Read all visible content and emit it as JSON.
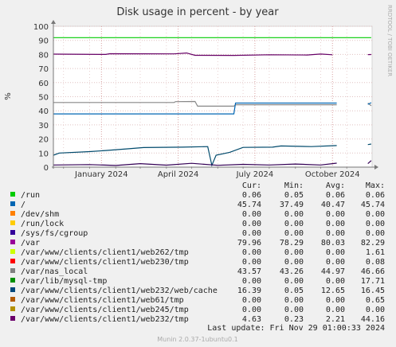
{
  "chart_data": {
    "type": "line",
    "title": "Disk usage in percent - by year",
    "ylabel": "%",
    "side_label": "RRDTOOL / TOBI OETIKER",
    "ylim": [
      0,
      100
    ],
    "yticks": [
      0,
      10,
      20,
      30,
      40,
      50,
      60,
      70,
      80,
      90,
      100
    ],
    "xlim": [
      "2023-11-19",
      "2024-12-01"
    ],
    "xticks": [
      {
        "label": "January 2024",
        "date": "2024-01-15"
      },
      {
        "label": "April 2024",
        "date": "2024-04-15"
      },
      {
        "label": "July 2024",
        "date": "2024-07-15"
      },
      {
        "label": "October 2024",
        "date": "2024-10-15"
      }
    ],
    "grid": true,
    "series": [
      {
        "name": "/run",
        "color": "#00cc00",
        "points": [
          [
            "2023-11-19",
            91.9
          ],
          [
            "2024-11-30",
            91.9
          ]
        ]
      },
      {
        "name": "/var",
        "color": "#660066",
        "points": [
          [
            "2023-11-19",
            80.2
          ],
          [
            "2024-01-20",
            80.0
          ],
          [
            "2024-01-25",
            80.5
          ],
          [
            "2024-04-10",
            80.4
          ],
          [
            "2024-04-25",
            81.0
          ],
          [
            "2024-05-05",
            79.4
          ],
          [
            "2024-06-20",
            79.3
          ],
          [
            "2024-08-01",
            79.8
          ],
          [
            "2024-09-15",
            79.6
          ],
          [
            "2024-10-01",
            80.3
          ],
          [
            "2024-10-15",
            79.8
          ],
          [
            "2024-10-20",
            null
          ],
          [
            "2024-11-26",
            79.9
          ],
          [
            "2024-11-30",
            79.96
          ]
        ]
      },
      {
        "name": "/var/nas_local",
        "color": "#888888",
        "points": [
          [
            "2023-11-19",
            45.9
          ],
          [
            "2024-04-10",
            45.9
          ],
          [
            "2024-04-12",
            46.5
          ],
          [
            "2024-05-05",
            46.6
          ],
          [
            "2024-05-08",
            43.3
          ],
          [
            "2024-06-20",
            43.3
          ],
          [
            "2024-06-22",
            44.3
          ],
          [
            "2024-10-20",
            44.3
          ],
          [
            "2024-10-21",
            null
          ],
          [
            "2024-11-26",
            45.5
          ],
          [
            "2024-11-30",
            43.57
          ]
        ]
      },
      {
        "name": "/",
        "color": "#0066b3",
        "points": [
          [
            "2023-11-19",
            37.8
          ],
          [
            "2024-06-20",
            37.8
          ],
          [
            "2024-06-22",
            45.5
          ],
          [
            "2024-10-20",
            45.5
          ],
          [
            "2024-10-21",
            null
          ],
          [
            "2024-11-26",
            44.6
          ],
          [
            "2024-11-30",
            45.74
          ]
        ]
      },
      {
        "name": "/var/www/clients/client1/web232/web/cache",
        "color": "#004a6c",
        "points": [
          [
            "2023-11-19",
            8.5
          ],
          [
            "2023-11-26",
            10.0
          ],
          [
            "2024-01-01",
            11.0
          ],
          [
            "2024-01-20",
            11.8
          ],
          [
            "2024-02-15",
            13.0
          ],
          [
            "2024-03-05",
            13.9
          ],
          [
            "2024-04-20",
            14.2
          ],
          [
            "2024-05-20",
            14.6
          ],
          [
            "2024-05-25",
            1.3
          ],
          [
            "2024-05-30",
            8.5
          ],
          [
            "2024-06-15",
            10.5
          ],
          [
            "2024-07-01",
            14.0
          ],
          [
            "2024-08-05",
            14.2
          ],
          [
            "2024-08-15",
            15.0
          ],
          [
            "2024-09-20",
            14.6
          ],
          [
            "2024-10-20",
            15.3
          ],
          [
            "2024-10-21",
            null
          ],
          [
            "2024-11-26",
            16.0
          ],
          [
            "2024-11-30",
            16.39
          ]
        ]
      },
      {
        "name": "/var/www/clients/client1/web232/tmp",
        "color": "#330055",
        "points": [
          [
            "2023-11-19",
            1.5
          ],
          [
            "2024-01-01",
            1.8
          ],
          [
            "2024-02-01",
            1.2
          ],
          [
            "2024-03-01",
            2.5
          ],
          [
            "2024-04-01",
            1.4
          ],
          [
            "2024-05-01",
            2.7
          ],
          [
            "2024-06-01",
            1.3
          ],
          [
            "2024-07-01",
            2.0
          ],
          [
            "2024-08-01",
            1.5
          ],
          [
            "2024-09-01",
            2.2
          ],
          [
            "2024-10-01",
            1.5
          ],
          [
            "2024-10-20",
            2.8
          ],
          [
            "2024-10-21",
            null
          ],
          [
            "2024-11-26",
            2.5
          ],
          [
            "2024-11-30",
            4.63
          ]
        ]
      }
    ]
  },
  "legend": {
    "headers": [
      "Cur:",
      "Min:",
      "Avg:",
      "Max:"
    ],
    "rows": [
      {
        "name": "/run",
        "color": "#00cc00",
        "cur": "0.06",
        "min": "0.05",
        "avg": "0.06",
        "max": "0.06"
      },
      {
        "name": "/",
        "color": "#0066b3",
        "cur": "45.74",
        "min": "37.49",
        "avg": "40.47",
        "max": "45.74"
      },
      {
        "name": "/dev/shm",
        "color": "#ff8000",
        "cur": "0.00",
        "min": "0.00",
        "avg": "0.00",
        "max": "0.00"
      },
      {
        "name": "/run/lock",
        "color": "#ffcc00",
        "cur": "0.00",
        "min": "0.00",
        "avg": "0.00",
        "max": "0.00"
      },
      {
        "name": "/sys/fs/cgroup",
        "color": "#330099",
        "cur": "0.00",
        "min": "0.00",
        "avg": "0.00",
        "max": "0.00"
      },
      {
        "name": "/var",
        "color": "#990099",
        "cur": "79.96",
        "min": "78.29",
        "avg": "80.03",
        "max": "82.29"
      },
      {
        "name": "/var/www/clients/client1/web262/tmp",
        "color": "#ccff00",
        "cur": "0.00",
        "min": "0.00",
        "avg": "0.00",
        "max": "1.61"
      },
      {
        "name": "/var/www/clients/client1/web230/tmp",
        "color": "#ff0000",
        "cur": "0.00",
        "min": "0.00",
        "avg": "0.00",
        "max": "0.08"
      },
      {
        "name": "/var/nas_local",
        "color": "#808080",
        "cur": "43.57",
        "min": "43.26",
        "avg": "44.97",
        "max": "46.66"
      },
      {
        "name": "/var/lib/mysql-tmp",
        "color": "#008f00",
        "cur": "0.00",
        "min": "0.00",
        "avg": "0.00",
        "max": "17.71"
      },
      {
        "name": "/var/www/clients/client1/web232/web/cache",
        "color": "#00487d",
        "cur": "16.39",
        "min": "0.05",
        "avg": "12.65",
        "max": "16.45"
      },
      {
        "name": "/var/www/clients/client1/web61/tmp",
        "color": "#b35a00",
        "cur": "0.00",
        "min": "0.00",
        "avg": "0.00",
        "max": "0.65"
      },
      {
        "name": "/var/www/clients/client1/web245/tmp",
        "color": "#b38f00",
        "cur": "0.00",
        "min": "0.00",
        "avg": "0.00",
        "max": "0.00"
      },
      {
        "name": "/var/www/clients/client1/web232/tmp",
        "color": "#6b006b",
        "cur": "4.63",
        "min": "0.23",
        "avg": "2.21",
        "max": "44.16"
      }
    ],
    "last_update": "Last update: Fri Nov 29 01:00:33 2024"
  },
  "footer": "Munin 2.0.37-1ubuntu0.1"
}
